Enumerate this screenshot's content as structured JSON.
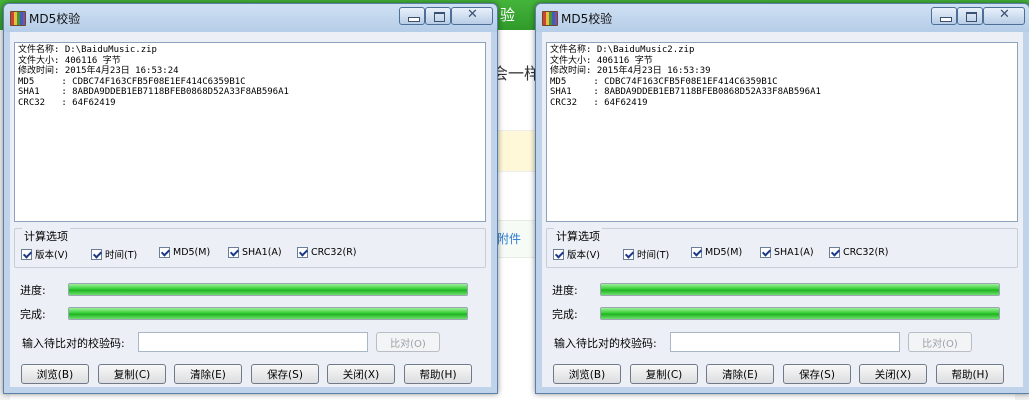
{
  "background": {
    "heading_fragment": "会一样",
    "link_fragment": "附件",
    "top_fragment": "验"
  },
  "windows": [
    {
      "title": "MD5校验",
      "info_lines": [
        "文件名称: D:\\BaiduMusic.zip",
        "文件大小: 406116 字节",
        "修改时间: 2015年4月23日 16:53:24",
        "MD5     : CDBC74F163CFB5F08E1EF414C6359B1C",
        "SHA1    : 8ABDA9DDEB1EB7118BFEB0868D52A33F8AB596A1",
        "CRC32   : 64F62419"
      ],
      "options_label": "计算选项",
      "options": [
        {
          "label": "版本(V)",
          "checked": true
        },
        {
          "label": "时间(T)",
          "checked": true
        },
        {
          "label": "MD5(M)",
          "checked": true
        },
        {
          "label": "SHA1(A)",
          "checked": true
        },
        {
          "label": "CRC32(R)",
          "checked": true
        }
      ],
      "progress_label": "进度:",
      "progress": 100,
      "complete_label": "完成:",
      "complete": 100,
      "compare_label": "输入待比对的校验码:",
      "compare_value": "",
      "compare_button": "比对(O)",
      "buttons": [
        "浏览(B)",
        "复制(C)",
        "清除(E)",
        "保存(S)",
        "关闭(X)",
        "帮助(H)"
      ]
    },
    {
      "title": "MD5校验",
      "info_lines": [
        "文件名称: D:\\BaiduMusic2.zip",
        "文件大小: 406116 字节",
        "修改时间: 2015年4月23日 16:53:39",
        "MD5     : CDBC74F163CFB5F08E1EF414C6359B1C",
        "SHA1    : 8ABDA9DDEB1EB7118BFEB0868D52A33F8AB596A1",
        "CRC32   : 64F62419"
      ],
      "options_label": "计算选项",
      "options": [
        {
          "label": "版本(V)",
          "checked": true
        },
        {
          "label": "时间(T)",
          "checked": true
        },
        {
          "label": "MD5(M)",
          "checked": true
        },
        {
          "label": "SHA1(A)",
          "checked": true
        },
        {
          "label": "CRC32(R)",
          "checked": true
        }
      ],
      "progress_label": "进度:",
      "progress": 100,
      "complete_label": "完成:",
      "complete": 100,
      "compare_label": "输入待比对的校验码:",
      "compare_value": "",
      "compare_button": "比对(O)",
      "buttons": [
        "浏览(B)",
        "复制(C)",
        "清除(E)",
        "保存(S)",
        "关闭(X)",
        "帮助(H)"
      ]
    }
  ],
  "colors": {
    "progress_green": "#2fc02f",
    "titlebar": "#b5cde8",
    "client_bg": "#ecf0f6"
  }
}
